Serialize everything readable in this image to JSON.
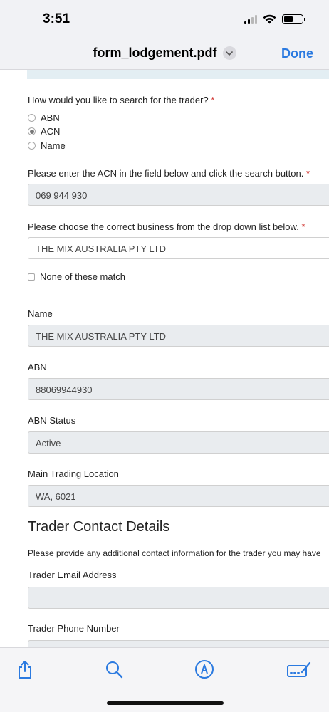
{
  "status": {
    "time": "3:51"
  },
  "nav": {
    "title": "form_lodgement.pdf",
    "done_label": "Done"
  },
  "form": {
    "search_question": "How would you like to search for the trader?",
    "required_mark": "*",
    "search_options": [
      "ABN",
      "ACN",
      "Name"
    ],
    "selected_option": "ACN",
    "acn_prompt": "Please enter the ACN in the field below and click the search button.",
    "acn_value": "069 944 930",
    "business_prompt": "Please choose the correct business from the drop down list below.",
    "business_value": "THE MIX AUSTRALIA PTY LTD",
    "no_match_label": "None of these match",
    "name_label": "Name",
    "name_value": "THE MIX AUSTRALIA PTY LTD",
    "abn_label": "ABN",
    "abn_value": "88069944930",
    "abn_status_label": "ABN Status",
    "abn_status_value": "Active",
    "location_label": "Main Trading Location",
    "location_value": "WA, 6021",
    "contact_heading": "Trader Contact Details",
    "contact_note": "Please provide any additional contact information for the trader you may have",
    "email_label": "Trader Email Address",
    "email_value": "",
    "phone_label": "Trader Phone Number"
  },
  "toolbar": {
    "icons": [
      "share-icon",
      "search-icon",
      "markup-icon",
      "fill-sign-icon"
    ]
  },
  "colors": {
    "accent": "#2b7ae0",
    "required": "#d0312d",
    "field_bg": "#e9ecef"
  }
}
